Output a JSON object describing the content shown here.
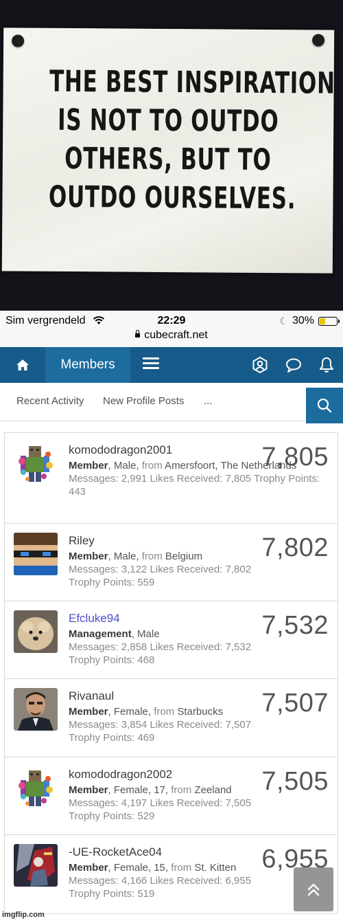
{
  "quote": {
    "lines": [
      "THE BEST INSPIRATION",
      "IS NOT TO OUTDO",
      "OTHERS, BUT TO",
      "OUTDO OURSELVES."
    ]
  },
  "status_bar": {
    "carrier": "Sim vergrendeld",
    "time": "22:29",
    "battery": "30%",
    "battery_level": 0.3,
    "url": "cubecraft.net"
  },
  "nav": {
    "active_tab": "Members",
    "icons": [
      "home-icon",
      "menu-icon",
      "account-icon",
      "conversations-icon",
      "alerts-icon"
    ]
  },
  "subnav": {
    "items": [
      "Recent Activity",
      "New Profile Posts",
      "..."
    ]
  },
  "members": [
    {
      "name": "komododragon2001",
      "role": "Member",
      "details": ", Male, ",
      "from_label": "from",
      "location": " Amersfoort, The Netherlands",
      "messages_label": "Messages:",
      "messages": "2,991",
      "likes_label": "Likes Received:",
      "likes": "7,805",
      "trophy_label": "Trophy Points:",
      "trophy": "443",
      "score": "7,805"
    },
    {
      "name": "Riley",
      "role": "Member",
      "details": ", Male, ",
      "from_label": "from",
      "location": " Belgium",
      "messages_label": "Messages:",
      "messages": "3,122",
      "likes_label": "Likes Received:",
      "likes": "7,802",
      "trophy_label": "Trophy Points:",
      "trophy": "559",
      "score": "7,802"
    },
    {
      "name": "Efcluke94",
      "role": "Management",
      "details": ", Male",
      "from_label": "",
      "location": "",
      "messages_label": "Messages:",
      "messages": "2,858",
      "likes_label": "Likes Received:",
      "likes": "7,532",
      "trophy_label": "Trophy Points:",
      "trophy": "468",
      "score": "7,532"
    },
    {
      "name": "Rivanaul",
      "role": "Member",
      "details": ", Female, ",
      "from_label": "from",
      "location": " Starbucks",
      "messages_label": "Messages:",
      "messages": "3,854",
      "likes_label": "Likes Received:",
      "likes": "7,507",
      "trophy_label": "Trophy Points:",
      "trophy": "469",
      "score": "7,507"
    },
    {
      "name": "komododragon2002",
      "role": "Member",
      "details": ", Female, 17, ",
      "from_label": "from",
      "location": " Zeeland",
      "messages_label": "Messages:",
      "messages": "4,197",
      "likes_label": "Likes Received:",
      "likes": "7,505",
      "trophy_label": "Trophy Points:",
      "trophy": "529",
      "score": "7,505"
    },
    {
      "name": "-UE-RocketAce04",
      "role": "Member",
      "details": ", Female, 15, ",
      "from_label": "from",
      "location": " St. Kitten",
      "messages_label": "Messages:",
      "messages": "4,166",
      "likes_label": "Likes Received:",
      "likes": "6,955",
      "trophy_label": "Trophy Points:",
      "trophy": "519",
      "score": "6,955"
    }
  ],
  "watermark": "imgflip.com",
  "colors": {
    "nav": "#165b89",
    "nav_active": "#1c6c9e",
    "staff_name": "#4a4fc9"
  }
}
